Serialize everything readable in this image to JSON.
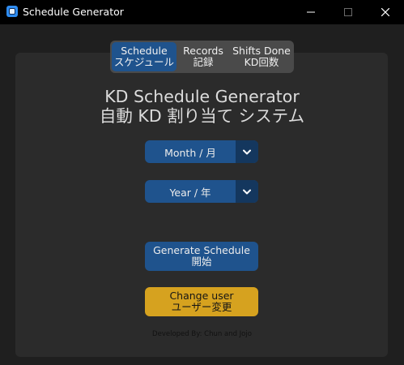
{
  "window": {
    "title": "Schedule Generator",
    "controls": {
      "minimize": "minimize-icon",
      "maximize": "maximize-icon",
      "close": "close-icon"
    }
  },
  "tabs": [
    {
      "label_line1": "Schedule",
      "label_line2": "スケジュール",
      "selected": true
    },
    {
      "label_line1": "Records",
      "label_line2": "記録",
      "selected": false
    },
    {
      "label_line1": "Shifts Done",
      "label_line2": "KD回数",
      "selected": false
    }
  ],
  "main": {
    "title_en": "KD Schedule Generator",
    "title_jp": "自動 KD 割り当て システム"
  },
  "month_select": {
    "value": "Month / 月",
    "icon": "chevron-down-icon"
  },
  "year_select": {
    "value": "Year / 年",
    "icon": "chevron-down-icon"
  },
  "buttons": {
    "generate_line1": "Generate Schedule",
    "generate_line2": "開始",
    "change_user_line1": "Change user",
    "change_user_line2": "ユーザー変更"
  },
  "footer": {
    "credit": "Developed By: Chun and Jojo"
  },
  "colors": {
    "accent": "#1f538d",
    "accent_dark": "#14375e",
    "warning": "#d6a21f",
    "panel": "#2b2b2b",
    "background": "#1f1f1f"
  }
}
